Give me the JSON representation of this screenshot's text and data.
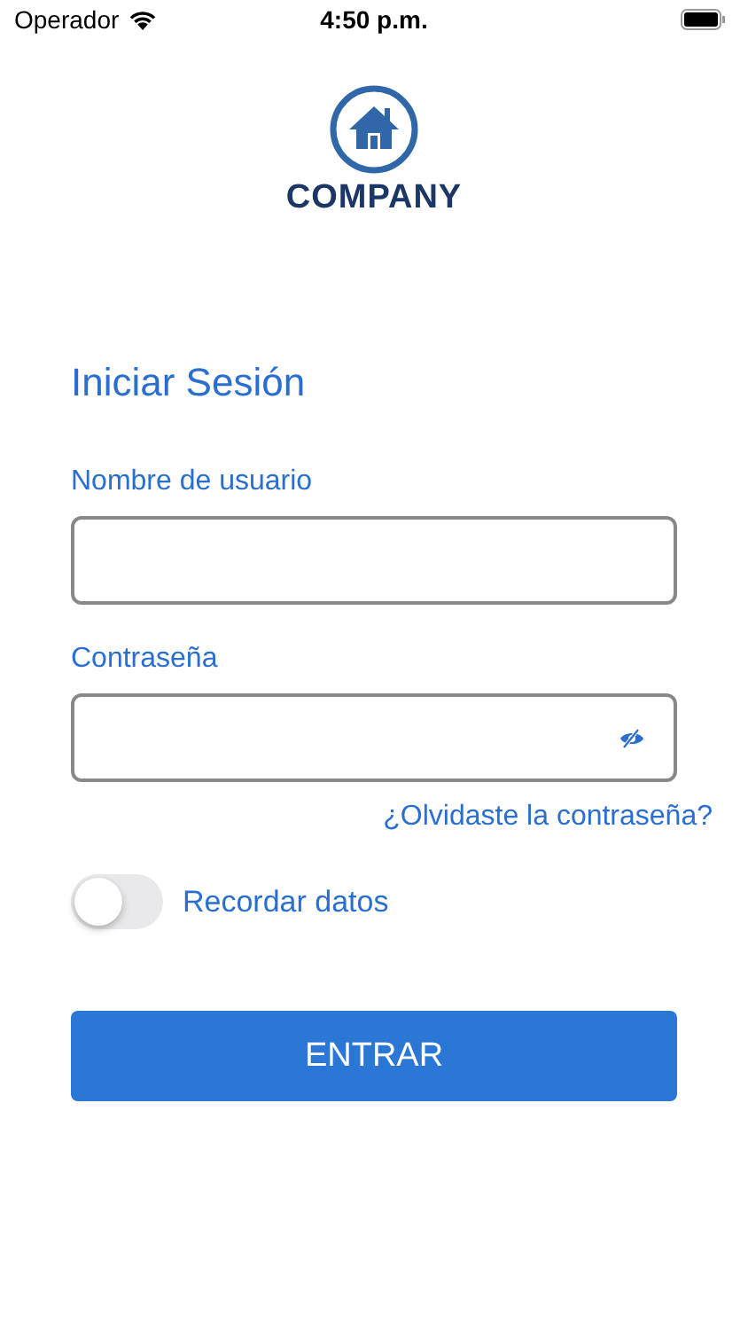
{
  "status_bar": {
    "carrier": "Operador",
    "time": "4:50 p.m."
  },
  "logo": {
    "name": "COMPANY"
  },
  "title": "Iniciar Sesión",
  "fields": [
    {
      "label": "Nombre de usuario",
      "kind": "text"
    },
    {
      "label": "Contraseña",
      "kind": "password"
    }
  ],
  "forgot_link": "¿Olvidaste la contraseña?",
  "remember": {
    "label": "Recordar datos",
    "on": false
  },
  "submit": "ENTRAR"
}
